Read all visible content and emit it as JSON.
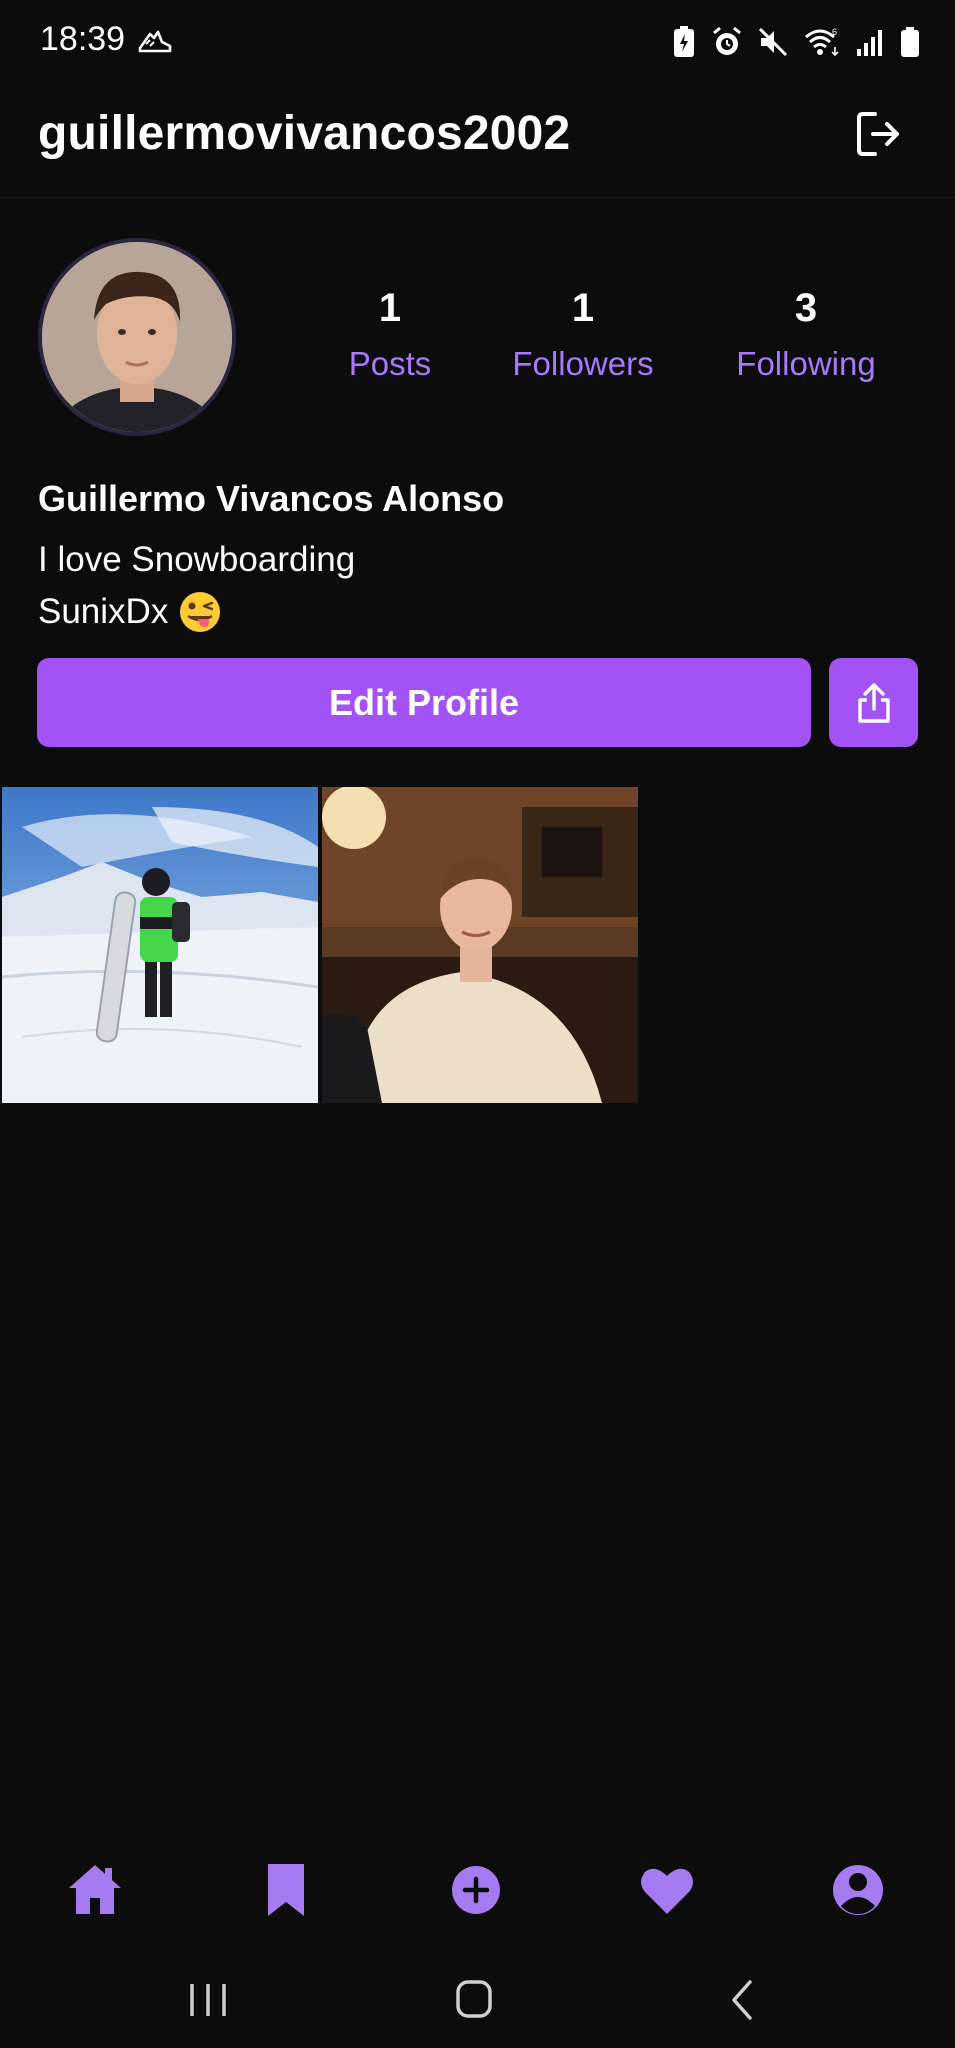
{
  "status_bar": {
    "time": "18:39",
    "left_icon": "sneaker-icon",
    "right_icons": [
      "battery-saver-icon",
      "alarm-icon",
      "mute-icon",
      "wifi-icon",
      "signal-icon",
      "battery-icon"
    ]
  },
  "header": {
    "username": "guillermovivancos2002",
    "logout_icon": "logout-icon"
  },
  "profile": {
    "stats": [
      {
        "count": "1",
        "label": "Posts"
      },
      {
        "count": "1",
        "label": "Followers"
      },
      {
        "count": "3",
        "label": "Following"
      }
    ],
    "full_name": "Guillermo Vivancos Alonso",
    "bio_line1": "I love Snowboarding",
    "bio_line2": "SunixDx",
    "bio_emoji": "winking-face-tongue-icon",
    "edit_button": "Edit Profile",
    "share_icon": "share-icon"
  },
  "posts": [
    "snowboard-photo",
    "restaurant-photo"
  ],
  "bottom_nav": [
    "home-icon",
    "bookmark-icon",
    "add-circle-icon",
    "heart-icon",
    "profile-icon"
  ],
  "colors": {
    "accent": "#a252f5",
    "accent_text": "#a878ff",
    "background": "#0c0c0d",
    "nav_icon": "#a47bf0"
  }
}
